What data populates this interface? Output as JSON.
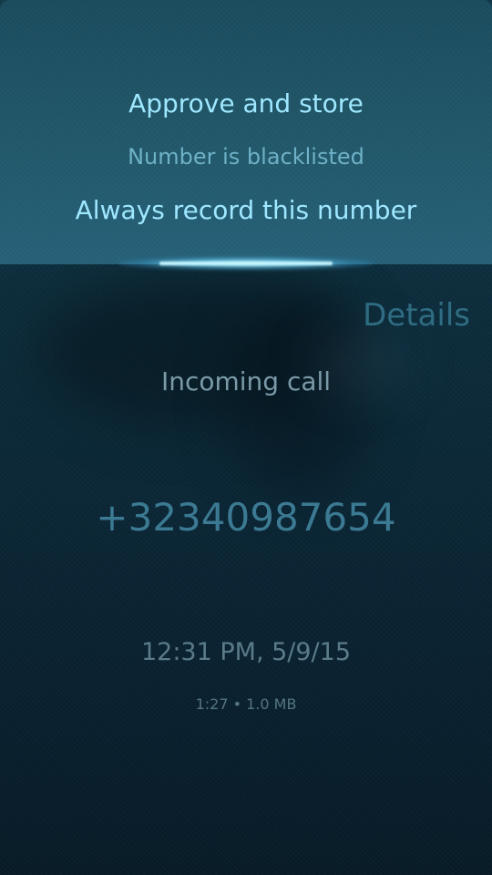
{
  "pulley_menu": {
    "items": [
      {
        "label": "Approve and store"
      },
      {
        "label": "Number is blacklisted"
      },
      {
        "label": "Always record this number"
      }
    ]
  },
  "page": {
    "header": "Details"
  },
  "call": {
    "type": "Incoming call",
    "number": "+32340987654",
    "datetime": "12:31 PM, 5/9/15",
    "meta": "1:27 • 1.0 MB"
  },
  "colors": {
    "highlight": "#9fe7ff",
    "secondary_highlight": "#6fb1c7",
    "header": "#2f6c82",
    "number": "#3b7a92"
  }
}
